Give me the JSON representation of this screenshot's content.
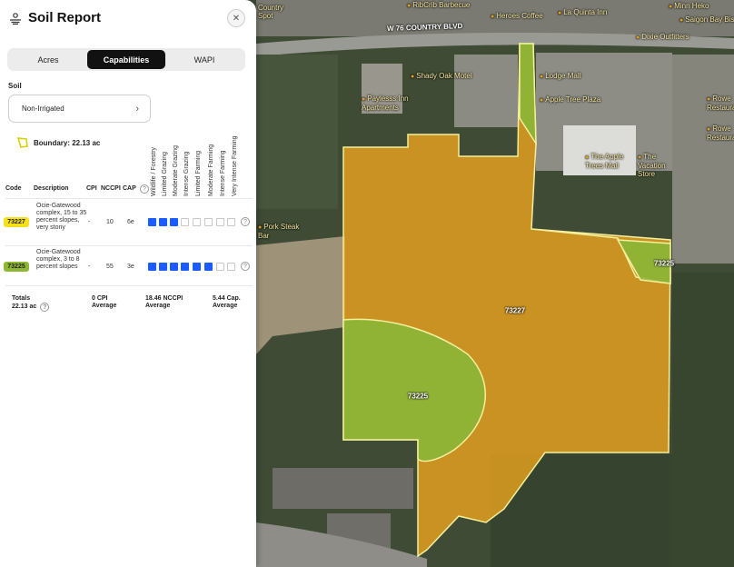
{
  "map": {
    "road_label": "W 76 COUNTRY BLVD",
    "pois": [
      {
        "name": "RibCrib Barbecue"
      },
      {
        "name": "Heroes Coffee"
      },
      {
        "name": "La Quinta Inn"
      },
      {
        "name": "Minn Heko"
      },
      {
        "name": "Saigon Bay Bistro"
      },
      {
        "name": "Dixie Outfitters"
      },
      {
        "name": "Shady Oak Motel"
      },
      {
        "name": "Paylesss Inn Apartments"
      },
      {
        "name": "Lodge Mall"
      },
      {
        "name": "Apple Tree Plaza"
      },
      {
        "name": "The Apple Trees Mall"
      },
      {
        "name": "The Vacation Store"
      },
      {
        "name": "Rowe Restaurant"
      },
      {
        "name": "Rowe Restaurant"
      },
      {
        "name": "Pork Steak Bar"
      },
      {
        "name": "Country Spot"
      }
    ],
    "soil_units": [
      {
        "label": "73227",
        "color": "#e8a21f"
      },
      {
        "label": "73225",
        "color": "#86b83a"
      },
      {
        "label": "73225",
        "color": "#86b83a"
      }
    ],
    "boundary_color": "#f3ef9a"
  },
  "panel": {
    "title": "Soil Report",
    "close_icon": "close-icon",
    "tabs": [
      {
        "label": "Acres",
        "active": false
      },
      {
        "label": "Capabilities",
        "active": true
      },
      {
        "label": "WAPI",
        "active": false
      }
    ],
    "soil_label": "Soil",
    "soil_select_value": "Non-Irrigated",
    "boundary_text": "Boundary: 22.13 ac",
    "capability_headers": [
      "Wildlife / Forestry",
      "Limited Grazing",
      "Moderate Grazing",
      "Intense Grazing",
      "Limited Farming",
      "Moderate Farming",
      "Intense Farming",
      "Very Intense Farming"
    ],
    "columns": {
      "code": "Code",
      "description": "Description",
      "cpi": "CPI",
      "nccpi": "NCCPI",
      "cap": "CAP"
    },
    "rows": [
      {
        "code": "73227",
        "badge_color": "#f6e01a",
        "description": "Ocie-Gatewood complex, 15 to 35 percent slopes, very stony",
        "cpi": "-",
        "nccpi": "10",
        "cap": "6e",
        "filled": 3
      },
      {
        "code": "73225",
        "badge_color": "#8fb832",
        "description": "Ocie-Gatewood complex, 3 to 8 percent slopes",
        "cpi": "-",
        "nccpi": "55",
        "cap": "3e",
        "filled": 6
      }
    ],
    "totals": {
      "label": "Totals",
      "acres": "22.13 ac",
      "cpi_value": "0 CPI",
      "cpi_sub": "Average",
      "nccpi_value": "18.46 NCCPI",
      "nccpi_sub": "Average",
      "cap_value": "5.44 Cap.",
      "cap_sub": "Average"
    }
  }
}
